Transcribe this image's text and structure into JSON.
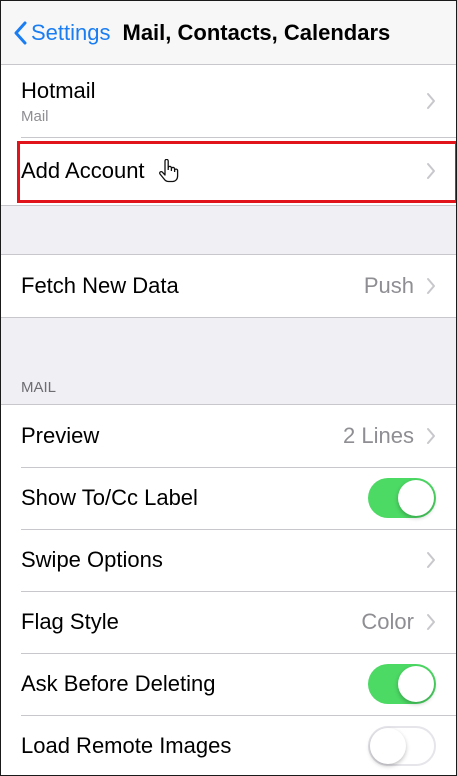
{
  "navbar": {
    "back_label": "Settings",
    "title": "Mail, Contacts, Calendars"
  },
  "accounts": {
    "hotmail": {
      "label": "Hotmail",
      "detail": "Mail"
    },
    "add_account": {
      "label": "Add Account"
    }
  },
  "fetch": {
    "label": "Fetch New Data",
    "value": "Push"
  },
  "mail_section": {
    "header": "MAIL",
    "preview": {
      "label": "Preview",
      "value": "2 Lines"
    },
    "show_to_cc": {
      "label": "Show To/Cc Label",
      "toggle": "on"
    },
    "swipe_options": {
      "label": "Swipe Options"
    },
    "flag_style": {
      "label": "Flag Style",
      "value": "Color"
    },
    "ask_before_deleting": {
      "label": "Ask Before Deleting",
      "toggle": "on"
    },
    "load_remote_images": {
      "label": "Load Remote Images",
      "toggle": "off"
    }
  },
  "colors": {
    "accent": "#1a7df2",
    "toggle_on": "#4cd964",
    "highlight": "#e0141a"
  },
  "icons": {
    "back": "chevron-left-icon",
    "disclosure": "chevron-right-icon",
    "cursor": "hand-pointer-icon"
  }
}
